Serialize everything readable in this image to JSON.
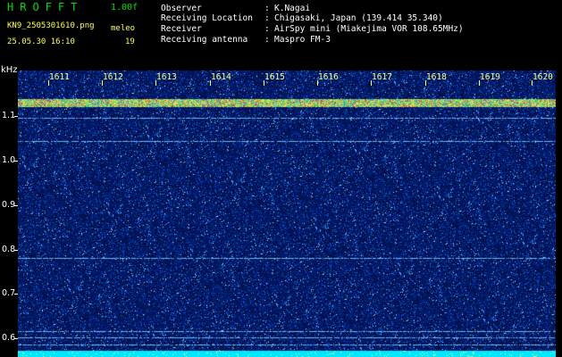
{
  "header": {
    "app_title": "HROFFT",
    "version": "1.00f",
    "filename": "KN9_2505301610.png",
    "timestamp": "25.05.30 16:10",
    "meleo_label": "meleo",
    "meleo_value": "19"
  },
  "info": [
    {
      "label": "Observer",
      "colon": ":",
      "value": "K.Nagai"
    },
    {
      "label": "Receiving Location",
      "colon": ":",
      "value": "Chigasaki, Japan (139.414 35.340)"
    },
    {
      "label": "Receiver",
      "colon": ":",
      "value": "AirSpy mini (Miakejima VOR 108.65MHz)"
    },
    {
      "label": "Receiving antenna",
      "colon": ":",
      "value": "Maspro FM-3"
    }
  ],
  "axis": {
    "unit": "kHz",
    "freq_ticks": [
      "1.1",
      "1.0",
      "0.9",
      "0.8",
      "0.7",
      "0.6"
    ],
    "time_ticks": [
      "1611",
      "1612",
      "1613",
      "1614",
      "1615",
      "1616",
      "1617",
      "1618",
      "1619",
      "1620"
    ]
  },
  "colors": {
    "background": "#000000",
    "title_green": "#00e000",
    "label_yellow": "#ffff40",
    "spectrum_base": "#00104a",
    "signal_band": "#e0e040",
    "noise_floor": "#00e8ff"
  }
}
